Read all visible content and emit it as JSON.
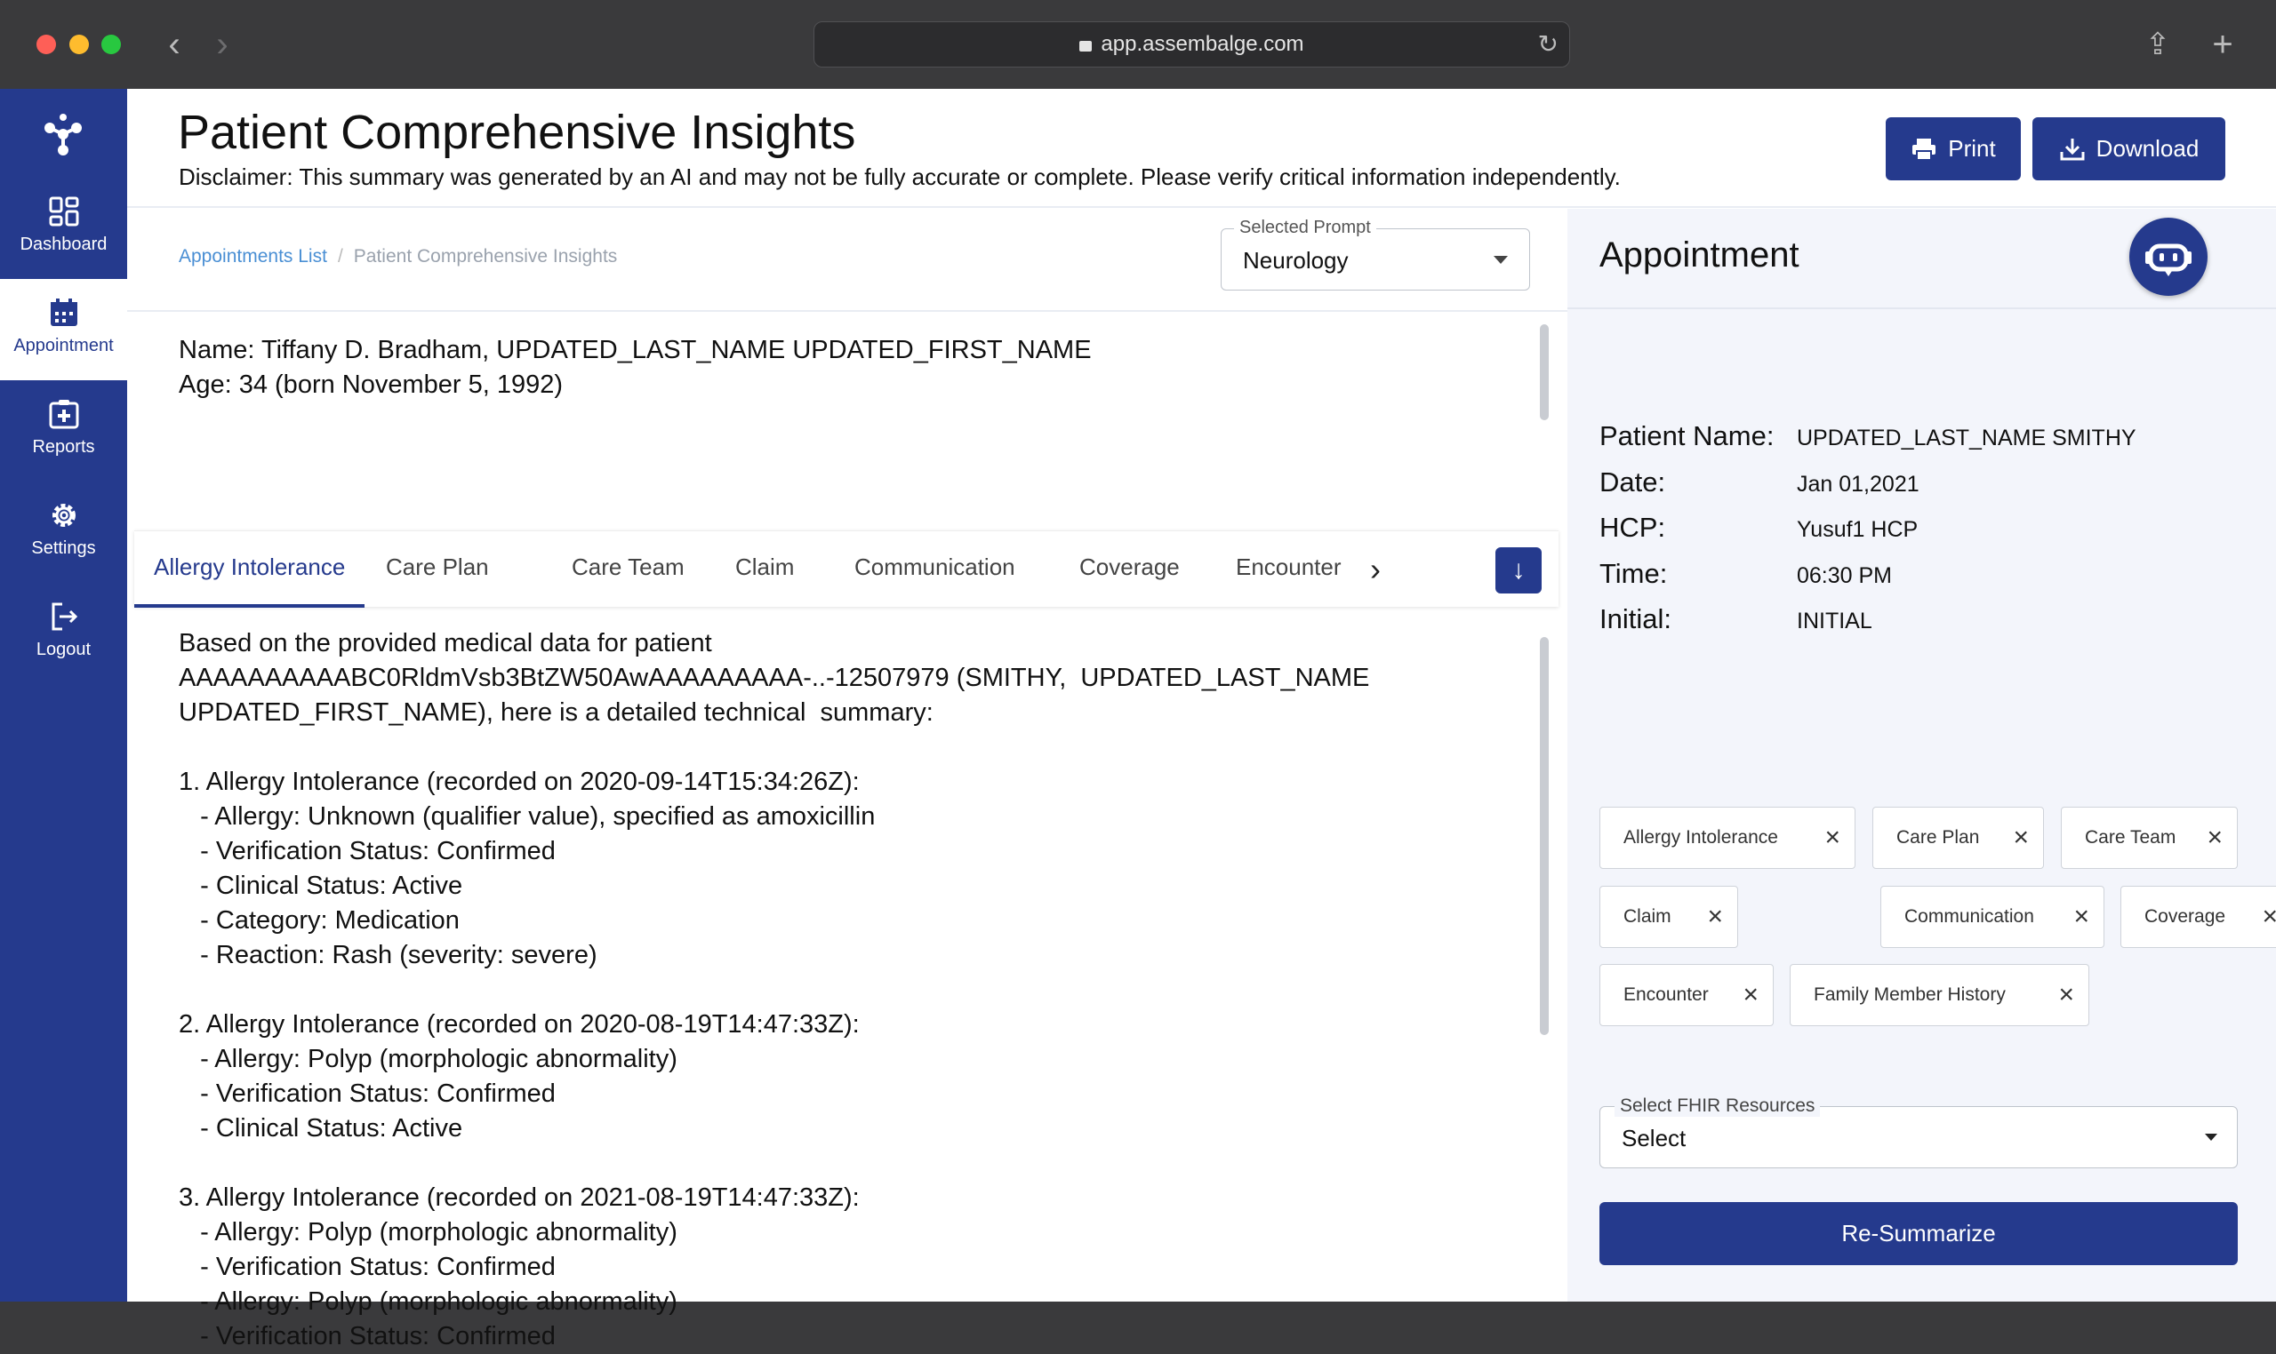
{
  "browser": {
    "url": "app.assembalge.com"
  },
  "sidebar": {
    "items": [
      {
        "label": "Dashboard",
        "icon": "dashboard-icon"
      },
      {
        "label": "Appointment",
        "icon": "calendar-icon"
      },
      {
        "label": "Reports",
        "icon": "reports-icon"
      },
      {
        "label": "Settings",
        "icon": "gear-icon"
      },
      {
        "label": "Logout",
        "icon": "logout-icon"
      }
    ],
    "active": "Appointment"
  },
  "header": {
    "title": "Patient Comprehensive Insights",
    "disclaimer": "Disclaimer: This summary was generated by an AI and may not be fully accurate or complete. Please verify critical information independently.",
    "print_label": "Print",
    "download_label": "Download"
  },
  "breadcrumb": {
    "link": "Appointments List",
    "current": "Patient Comprehensive Insights"
  },
  "prompt_select": {
    "legend": "Selected Prompt",
    "value": "Neurology"
  },
  "patient": {
    "name_line": "Name: Tiffany D. Bradham, UPDATED_LAST_NAME UPDATED_FIRST_NAME",
    "age_line": "Age: 34 (born November 5, 1992)"
  },
  "tabs": [
    "Allergy Intolerance",
    "Care Plan",
    "Care Team",
    "Claim",
    "Communication",
    "Coverage",
    "Encounter"
  ],
  "summary_text": "Based on the provided medical data for patient\nAAAAAAAAAABC0RldmVsb3BtZW50AwAAAAAAAAA-..-12507979 (SMITHY,  UPDATED_LAST_NAME\nUPDATED_FIRST_NAME), here is a detailed technical  summary:\n\n1. Allergy Intolerance (recorded on 2020-09-14T15:34:26Z):\n   - Allergy: Unknown (qualifier value), specified as amoxicillin\n   - Verification Status: Confirmed\n   - Clinical Status: Active\n   - Category: Medication\n   - Reaction: Rash (severity: severe)\n\n2. Allergy Intolerance (recorded on 2020-08-19T14:47:33Z):\n   - Allergy: Polyp (morphologic abnormality)\n   - Verification Status: Confirmed\n   - Clinical Status: Active\n\n3. Allergy Intolerance (recorded on 2021-08-19T14:47:33Z):\n   - Allergy: Polyp (morphologic abnormality)\n   - Verification Status: Confirmed\n   - Allergy: Polyp (morphologic abnormality)\n   - Verification Status: Confirmed",
  "appointment": {
    "title": "Appointment",
    "fields": [
      {
        "key": "Patient Name:",
        "value": "UPDATED_LAST_NAME SMITHY"
      },
      {
        "key": "Date:",
        "value": "Jan 01,2021"
      },
      {
        "key": "HCP:",
        "value": "Yusuf1 HCP"
      },
      {
        "key": "Time:",
        "value": "06:30 PM"
      },
      {
        "key": "Initial:",
        "value": "INITIAL"
      }
    ],
    "chips": [
      "Allergy Intolerance",
      "Care Plan",
      "Care Team",
      "Claim",
      "Communication",
      "Coverage",
      "Encounter",
      "Family Member History"
    ],
    "fhir_select": {
      "legend": "Select FHIR Resources",
      "value": "Select"
    },
    "resummarize_label": "Re-Summarize"
  },
  "colors": {
    "primary": "#253a8d",
    "link": "#4a8fd4",
    "panel_bg": "#f3f5fb"
  }
}
